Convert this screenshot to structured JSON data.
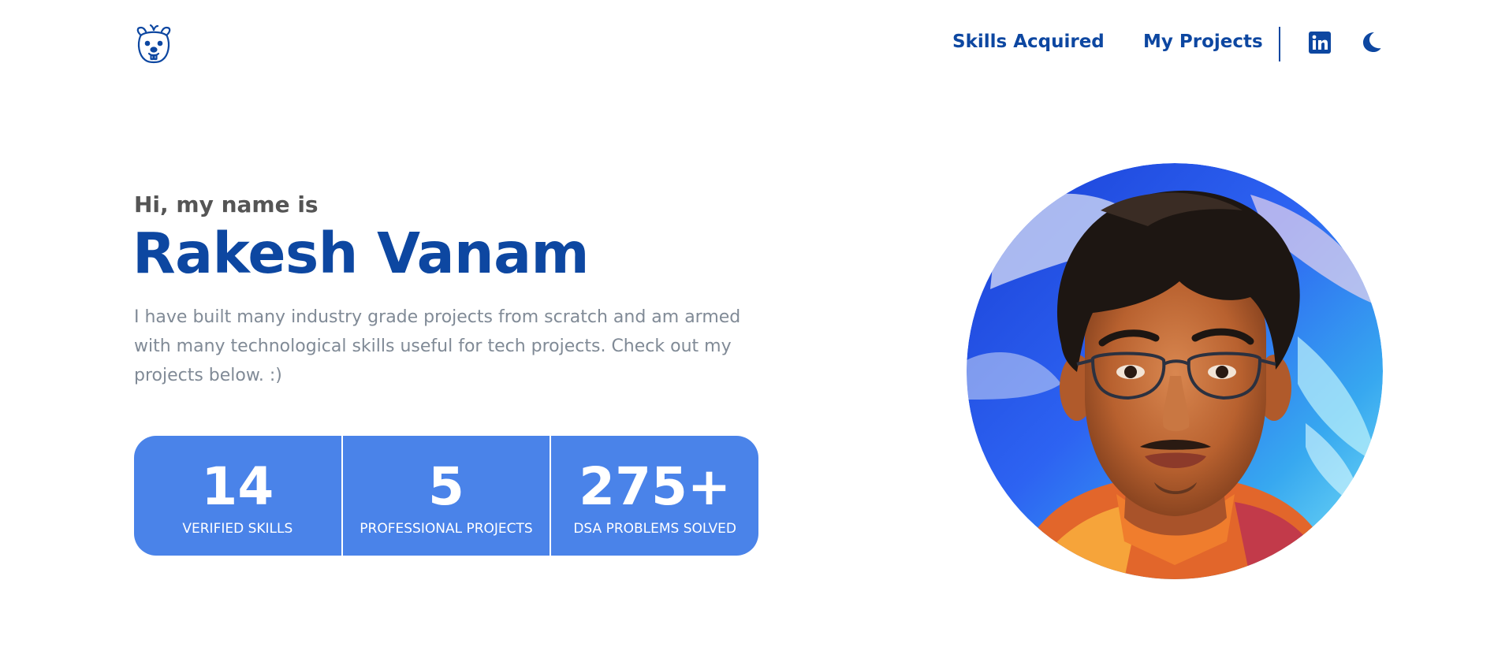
{
  "header": {
    "logo_icon": "beaver-logo-icon",
    "nav": [
      {
        "label": "Skills Acquired"
      },
      {
        "label": "My Projects"
      }
    ],
    "linkedin_icon": "linkedin-icon",
    "theme_toggle_icon": "moon-icon"
  },
  "hero": {
    "greeting": "Hi, my name is",
    "name": "Rakesh Vanam",
    "description": "I have built many industry grade projects from scratch and am armed with many technological skills useful for tech projects. Check out my projects below. :)"
  },
  "stats": [
    {
      "value": "14",
      "label": "VERIFIED SKILLS"
    },
    {
      "value": "5",
      "label": "PROFESSIONAL PROJECTS"
    },
    {
      "value": "275+",
      "label": "DSA PROBLEMS SOLVED"
    }
  ],
  "colors": {
    "accent": "#0d47a1",
    "stats_bg": "#4a83e9",
    "muted_text": "#808a96",
    "greeting_text": "#555555"
  }
}
